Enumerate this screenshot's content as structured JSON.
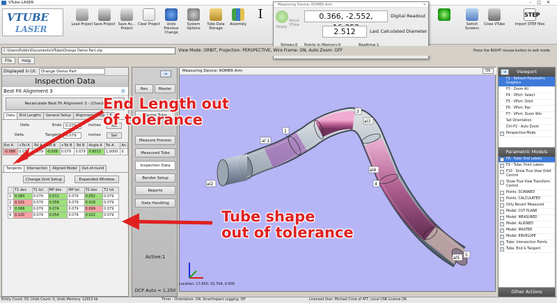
{
  "app": {
    "title": "VTube-LASER"
  },
  "ribbon": {
    "logo_top": "VTUBE",
    "logo_bottom": "LASER",
    "buttons": [
      {
        "label": "Load Project",
        "icon": "folder-icon"
      },
      {
        "label": "Save Project",
        "icon": "save-icon"
      },
      {
        "label": "Save As... Project",
        "icon": "save-as-icon"
      },
      {
        "label": "Clear Project",
        "icon": "clear-icon"
      },
      {
        "label": "Undo Previous Change",
        "icon": "undo-icon"
      },
      {
        "label": "System Options",
        "icon": "gear-icon"
      },
      {
        "label": "Tube Data Storage",
        "icon": "tube-storage-icon"
      },
      {
        "label": "Assembly",
        "icon": "assembly-icon"
      }
    ],
    "cursor_glyph": "I",
    "switch_screens": "Switch Screens",
    "close_vtube": "Close VTube",
    "import_step": "Import STEP files",
    "step_badge": "STEP"
  },
  "measuring_device": {
    "title": "Measuring Device: ROMER Arm",
    "ready": "Ready",
    "about": "About VTube",
    "readout": "0.366, -2.552, 16.352",
    "readout_label": "Digital Readout",
    "diameter": "2.512",
    "diameter_label": "Last Calculated Diameter",
    "stripes": "Stripes:0",
    "points": "Points in Memory:0",
    "realtime": "Realtime:1",
    "percentage": "Percentage of Points Below the Cut Planes: 0"
  },
  "path": "C:\\Users\\Public\\Documents\\VTube\\Orange Demo Part.vtp",
  "view_mode": "View Mode: ORBIT, Projection: PERSPECTIVE, Wire Frame: ON, Auto Zoom: OFF",
  "hint": "Press the RIGHT mouse button to exit mode",
  "menu": [
    "File",
    "Help"
  ],
  "left": {
    "displayed_label": "Displayed in UI:",
    "displayed_value": "Orange Demo Part",
    "title": "Inspection Data",
    "alignment": "Best Fit Alignment 3",
    "recalc": "Recalculate Best Fit Alignment 3 - (Check)",
    "tabs": [
      "Data",
      "End Lengths",
      "General Setup",
      "Alignment Setup",
      "E"
    ],
    "row1": {
      "label": "Defa",
      "ends_label": "Ends",
      "value": "0.079",
      "unit": "inches",
      "button": "Set"
    },
    "row2": {
      "label": "Defa",
      "tangents_label": "Tangents",
      "value": "0.079",
      "unit": "inches",
      "button": "Set"
    },
    "end_table": {
      "headers": [
        "Ext A",
        "+Tol A",
        "-Tol A",
        "Ext B",
        "+Tol B",
        "-Tol B",
        "Angle A",
        "Tol A",
        "An"
      ],
      "row": [
        "-0.088",
        "0.079",
        "0.079",
        "-0.008",
        "0.079",
        "0.079",
        "0.8013",
        "1.0000",
        "0."
      ]
    },
    "tabs2": [
      "Tangents",
      "Intersection",
      "Aligned Model",
      "Out-of-round"
    ],
    "grid_btn": "Change Grid Setup",
    "expand_btn": "Expanded Window",
    "tan_table": {
      "headers": [
        "",
        "T1 dev",
        "T1 tol",
        "MP dev",
        "MP tol",
        "T2 dev",
        "T2 tol"
      ],
      "rows": [
        [
          "1",
          "0.060",
          "0.079",
          "0.011",
          "0.079",
          "0.052",
          "0.079"
        ],
        [
          "2",
          "0.101",
          "0.079",
          "0.058",
          "0.079",
          "0.018",
          "0.079"
        ],
        [
          "3",
          "0.068",
          "0.079",
          "0.074",
          "0.079",
          "0.099",
          "0.079"
        ],
        [
          "4",
          "0.100",
          "0.079",
          "0.054",
          "0.079",
          "0.022",
          "0.079"
        ]
      ]
    }
  },
  "middle": {
    "rev": "Rev",
    "master": "Master",
    "menu": [
      "Master Tube",
      "Measure Process",
      "Measured Tube",
      "Inspection Data",
      "Bender Setup",
      "Reports",
      "Data Handling"
    ],
    "active": "Active:1",
    "dcp": "DCP Auto = 1.250"
  },
  "viewport": {
    "title": "Measuring Device: ROMER Arm",
    "ok": "OK",
    "location": "Location: 17.650, 52.704, 0.000",
    "labels": [
      "1",
      "al 1",
      "3",
      "al3",
      "al2",
      "al4",
      "4",
      "al5",
      "5"
    ]
  },
  "right": {
    "viewport_head": "Viewport",
    "viewport_items": [
      "F2 - Refresh Parametric Graphics",
      "F3 - Zoom All",
      "F4 - VPort: Select",
      "F5 - VPort: Orbit",
      "F6 - VPort: Pan",
      "F7 - VPort: Zoom Win",
      "Set Orientation",
      "Ctrl-F2 - Auto Zoom",
      "Perspective Mode"
    ],
    "param_head": "Parametric Models",
    "param_items": [
      {
        "label": "F8 - Tube: End Labels",
        "checked": true,
        "selected": true
      },
      {
        "label": "F9 - Tube: Point Labels",
        "checked": true,
        "selected": false
      },
      {
        "label": "F10 - Show True View Orbit Control",
        "checked": false,
        "selected": false
      },
      {
        "label": "Show True View Transform Control",
        "checked": false,
        "selected": false
      },
      {
        "label": "Points: SCANNED",
        "checked": false,
        "selected": false
      },
      {
        "label": "Points: CALCULATED",
        "checked": false,
        "selected": false
      },
      {
        "label": "Only Recent Measured",
        "checked": false,
        "selected": false
      },
      {
        "label": "Model: CUT PLANE",
        "checked": false,
        "selected": false
      },
      {
        "label": "Model: MEASURED",
        "checked": false,
        "selected": false
      },
      {
        "label": "Model: ALIGNED",
        "checked": true,
        "selected": false
      },
      {
        "label": "Model: MASTER",
        "checked": true,
        "selected": false
      },
      {
        "label": "Model: ENVELOPE",
        "checked": true,
        "selected": false
      },
      {
        "label": "Tube: Intersection Points",
        "checked": true,
        "selected": false
      },
      {
        "label": "Tube: End & Tangent",
        "checked": true,
        "selected": false
      }
    ],
    "other_head": "Other Actions"
  },
  "status": {
    "left": "Entity Count: 50, Undo Count: 0, Undo Memory: 12913 kb",
    "mid": "Timer - Orientation: ON, Smarthspect Logging: Off",
    "right": "Licensed User: Michael Cone of ATT, Local USB License OK"
  },
  "annotations": {
    "end_length_1": "End Length out",
    "end_length_2": "of tolerance",
    "tube_shape_1": "Tube shape",
    "tube_shape_2": "out of tolerance"
  },
  "colors": {
    "viewport_bg": "#b6b5f6",
    "out_of_tol": "#f7a3a3",
    "in_tol": "#9ee07a",
    "annotation": "#e02020"
  }
}
